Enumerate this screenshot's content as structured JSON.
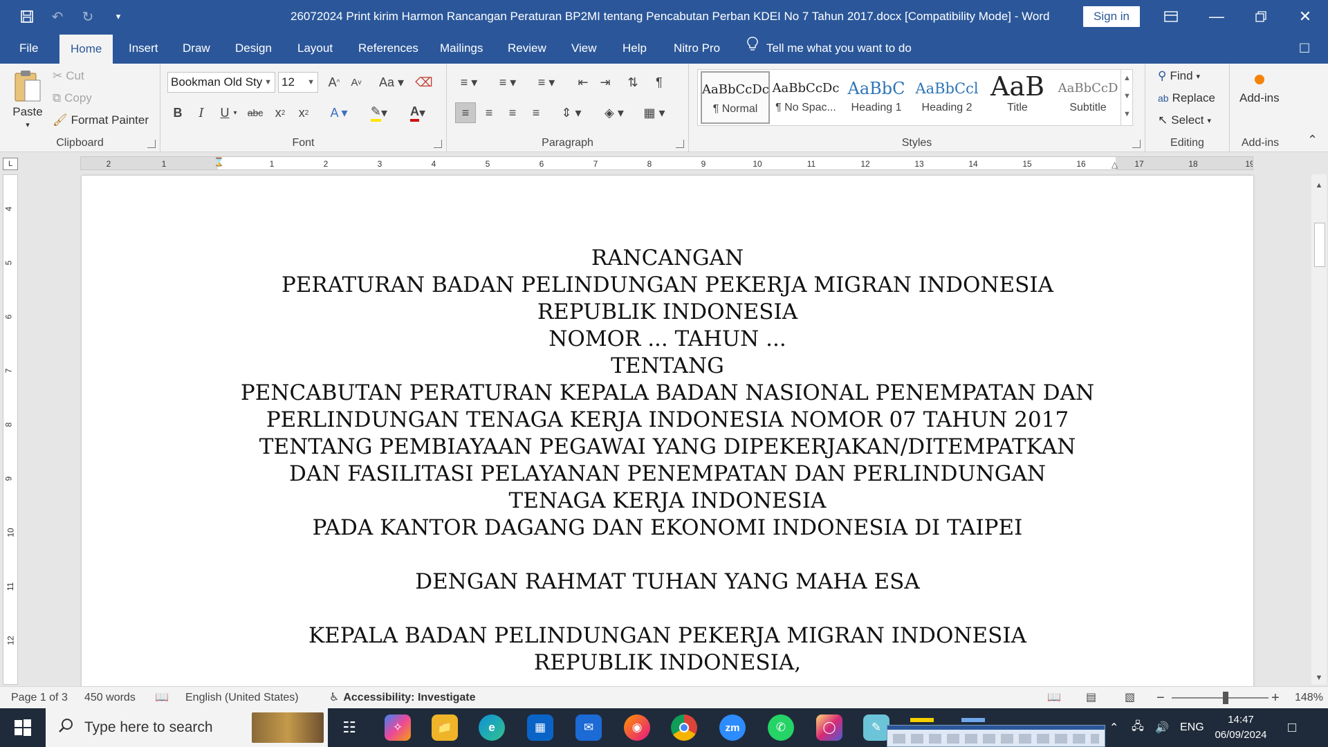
{
  "window": {
    "title": "26072024 Print kirim Harmon Rancangan Peraturan BP2MI tentang Pencabutan Perban KDEI No 7 Tahun 2017.docx [Compatibility Mode]  -  Word",
    "sign_in": "Sign in"
  },
  "tabs": [
    "File",
    "Home",
    "Insert",
    "Draw",
    "Design",
    "Layout",
    "References",
    "Mailings",
    "Review",
    "View",
    "Help",
    "Nitro Pro"
  ],
  "tell_me": "Tell me what you want to do",
  "ribbon": {
    "clipboard": {
      "label": "Clipboard",
      "paste": "Paste",
      "cut": "Cut",
      "copy": "Copy",
      "format_painter": "Format Painter"
    },
    "font": {
      "label": "Font",
      "font_name": "Bookman Old Sty",
      "font_size": "12"
    },
    "paragraph": {
      "label": "Paragraph"
    },
    "styles": {
      "label": "Styles",
      "items": [
        {
          "preview": "AaBbCcDc",
          "name": "¶ Normal"
        },
        {
          "preview": "AaBbCcDc",
          "name": "¶ No Spac..."
        },
        {
          "preview": "AaBbC",
          "name": "Heading 1"
        },
        {
          "preview": "AaBbCcl",
          "name": "Heading 2"
        },
        {
          "preview": "AaB",
          "name": "Title"
        },
        {
          "preview": "AaBbCcD",
          "name": "Subtitle"
        }
      ]
    },
    "editing": {
      "label": "Editing",
      "find": "Find",
      "replace": "Replace",
      "select": "Select"
    },
    "addins": {
      "label": "Add-ins",
      "button": "Add-ins"
    }
  },
  "ruler": {
    "h_ticks": [
      "2",
      "1",
      "1",
      "2",
      "3",
      "4",
      "5",
      "6",
      "7",
      "8",
      "9",
      "10",
      "11",
      "12",
      "13",
      "14",
      "15",
      "16",
      "17",
      "18",
      "19"
    ],
    "v_ticks": [
      "4",
      "5",
      "6",
      "7",
      "8",
      "9",
      "10",
      "11",
      "12"
    ]
  },
  "document": {
    "lines": [
      "RANCANGAN",
      "PERATURAN BADAN PELINDUNGAN PEKERJA MIGRAN INDONESIA",
      "REPUBLIK INDONESIA",
      "NOMOR ...  TAHUN ...",
      "TENTANG",
      "PENCABUTAN PERATURAN KEPALA BADAN NASIONAL PENEMPATAN DAN",
      "PERLINDUNGAN TENAGA KERJA INDONESIA NOMOR 07 TAHUN 2017",
      "TENTANG PEMBIAYAAN PEGAWAI YANG DIPEKERJAKAN/DITEMPATKAN",
      "DAN FASILITASI PELAYANAN PENEMPATAN DAN PERLINDUNGAN",
      "TENAGA KERJA INDONESIA",
      "PADA KANTOR DAGANG DAN EKONOMI INDONESIA DI TAIPEI",
      "",
      "DENGAN RAHMAT TUHAN YANG MAHA ESA",
      "",
      "KEPALA BADAN PELINDUNGAN PEKERJA MIGRAN INDONESIA",
      "REPUBLIK INDONESIA,"
    ]
  },
  "status": {
    "page": "Page 1 of 3",
    "words": "450 words",
    "language": "English (United States)",
    "accessibility": "Accessibility: Investigate",
    "zoom": "148%"
  },
  "taskbar": {
    "search_placeholder": "Type here to search",
    "lang": "ENG",
    "time": "14:47",
    "date": "06/09/2024"
  },
  "colors": {
    "word_blue": "#2b579a",
    "taskbar": "#1f2b3a"
  }
}
